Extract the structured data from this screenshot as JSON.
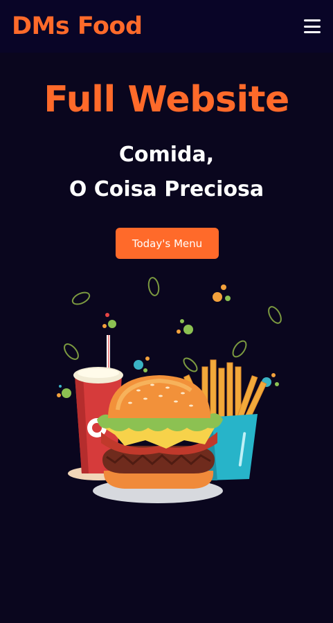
{
  "header": {
    "brand": "DMs Food",
    "menu_icon": "hamburger-menu-icon"
  },
  "hero": {
    "title": "Full Website",
    "subtitle_line1": "Comida,",
    "subtitle_line2": "O Coisa Preciosa",
    "cta_label": "Today's Menu"
  },
  "illustration": {
    "name": "food-illustration",
    "items": [
      "soda-cup",
      "burger",
      "french-fries",
      "leaf-icon",
      "confetti-dot"
    ]
  },
  "colors": {
    "background": "#0a061e",
    "navbar": "#090527",
    "accent": "#ff6a2a",
    "text": "#ffffff"
  }
}
